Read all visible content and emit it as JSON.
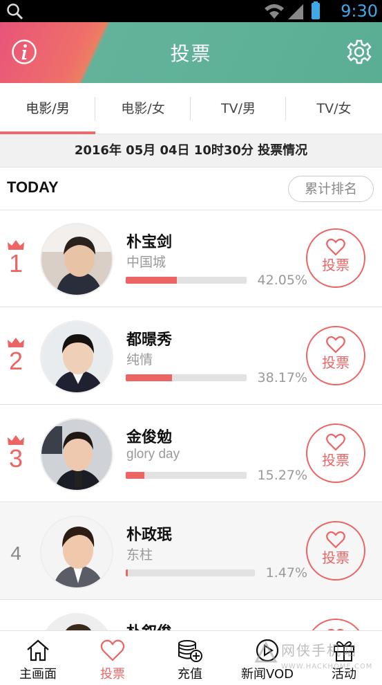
{
  "status": {
    "time": "9:30"
  },
  "header": {
    "title": "投票"
  },
  "tabs": [
    {
      "label": "电影/男",
      "active": true
    },
    {
      "label": "电影/女",
      "active": false
    },
    {
      "label": "TV/男",
      "active": false
    },
    {
      "label": "TV/女",
      "active": false
    }
  ],
  "date_line": "2016年 05月 04日 10时30分 投票情况",
  "today": {
    "label": "TODAY",
    "rank_button": "累计排名"
  },
  "candidates": [
    {
      "rank": "1",
      "name": "朴宝剑",
      "work": "中国城",
      "percent": "42.05%",
      "fraction": 0.4205,
      "vote_label": "投票"
    },
    {
      "rank": "2",
      "name": "都暻秀",
      "work": "纯情",
      "percent": "38.17%",
      "fraction": 0.3817,
      "vote_label": "投票"
    },
    {
      "rank": "3",
      "name": "金俊勉",
      "work": "glory day",
      "percent": "15.27%",
      "fraction": 0.1527,
      "vote_label": "投票"
    },
    {
      "rank": "4",
      "name": "朴政珉",
      "work": "东柱",
      "percent": "1.47%",
      "fraction": 0.0147,
      "vote_label": "投票"
    },
    {
      "rank": "",
      "name": "朴叙俊",
      "work": "",
      "percent": "",
      "fraction": 0,
      "vote_label": "投票"
    }
  ],
  "nav": [
    {
      "label": "主画面",
      "icon": "home-icon",
      "active": false
    },
    {
      "label": "投票",
      "icon": "heart-icon",
      "active": true
    },
    {
      "label": "充值",
      "icon": "coins-add-icon",
      "active": false
    },
    {
      "label": "新闻VOD",
      "icon": "play-circle-icon",
      "active": false
    },
    {
      "label": "活动",
      "icon": "gift-icon",
      "active": false
    }
  ],
  "watermark": {
    "line1": "网侠手机站",
    "line2": "WWW.HACKHOME.COM"
  },
  "colors": {
    "accent": "#ec6464",
    "header_left": "#e8547a",
    "header_right": "#5aae93",
    "status_blue": "#3fa9e8"
  }
}
